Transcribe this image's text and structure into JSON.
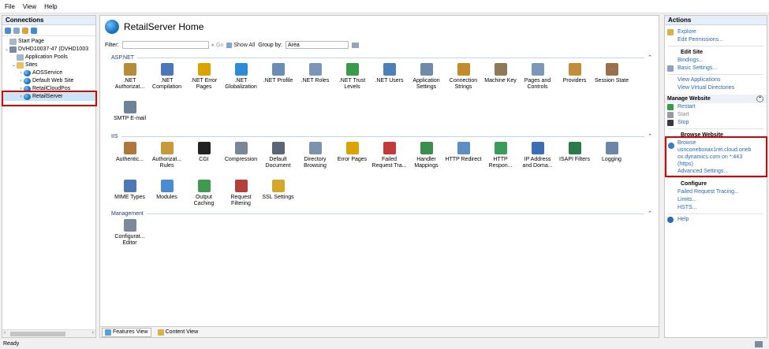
{
  "menu": [
    "File",
    "View",
    "Help"
  ],
  "connections": {
    "title": "Connections",
    "tree": [
      {
        "label": "Start Page",
        "indent": 0,
        "icon": "start-page-icon"
      },
      {
        "label": "DVHD10037-47 (DVHD1003",
        "indent": 0,
        "icon": "server-icon",
        "chev": "⌄"
      },
      {
        "label": "Application Pools",
        "indent": 1,
        "icon": "app-pools-icon"
      },
      {
        "label": "Sites",
        "indent": 1,
        "icon": "sites-folder-icon",
        "chev": "⌄"
      },
      {
        "label": "AOSService",
        "indent": 2,
        "icon": "globe-icon",
        "chev": "›"
      },
      {
        "label": "Default Web Site",
        "indent": 2,
        "icon": "globe-icon",
        "chev": "›"
      },
      {
        "label": "RetailCloudPos",
        "indent": 2,
        "icon": "globe-icon",
        "chev": "›"
      },
      {
        "label": "RetailServer",
        "indent": 2,
        "icon": "globe-icon",
        "chev": "›",
        "selected": true
      }
    ]
  },
  "main": {
    "title": "RetailServer Home",
    "filter_label": "Filter:",
    "go_label": "Go",
    "show_all_label": "Show All",
    "group_by_label": "Group by:",
    "group_by_value": "Area",
    "sections": [
      {
        "name": "ASP.NET",
        "rows": [
          [
            {
              "label": ".NET Authorizat...",
              "color": "#b58d3a"
            },
            {
              "label": ".NET Compilation",
              "color": "#4d78b8"
            },
            {
              "label": ".NET Error Pages",
              "color": "#d9a400"
            },
            {
              "label": ".NET Globalization",
              "color": "#2e8bd5"
            },
            {
              "label": ".NET Profile",
              "color": "#6b8cb5"
            },
            {
              "label": ".NET Roles",
              "color": "#7d95b6"
            },
            {
              "label": ".NET Trust Levels",
              "color": "#3a9a4a"
            },
            {
              "label": ".NET Users",
              "color": "#4e7fb5"
            },
            {
              "label": "Application Settings",
              "color": "#708aa8"
            },
            {
              "label": "Connection Strings",
              "color": "#c48a2e"
            },
            {
              "label": "Machine Key",
              "color": "#8e7a5a"
            },
            {
              "label": "Pages and Controls",
              "color": "#7c97b8"
            },
            {
              "label": "Providers",
              "color": "#c28d3a"
            },
            {
              "label": "Session State",
              "color": "#9a6f4c"
            }
          ],
          [
            {
              "label": "SMTP E-mail",
              "color": "#6f8397"
            }
          ]
        ]
      },
      {
        "name": "IIS",
        "rows": [
          [
            {
              "label": "Authentic...",
              "color": "#b0763a"
            },
            {
              "label": "Authorizat... Rules",
              "color": "#c59a3d"
            },
            {
              "label": "CGI",
              "color": "#222222"
            },
            {
              "label": "Compression",
              "color": "#7a8796"
            },
            {
              "label": "Default Document",
              "color": "#5a6675"
            },
            {
              "label": "Directory Browsing",
              "color": "#7b93ad"
            },
            {
              "label": "Error Pages",
              "color": "#d9a400"
            },
            {
              "label": "Failed Request Tra...",
              "color": "#c23a3a"
            },
            {
              "label": "Handler Mappings",
              "color": "#3a8f4f"
            },
            {
              "label": "HTTP Redirect",
              "color": "#5f8fc2"
            },
            {
              "label": "HTTP Respon...",
              "color": "#3c9a5a"
            },
            {
              "label": "IP Address and Doma...",
              "color": "#3b6fb3"
            },
            {
              "label": "ISAPI Filters",
              "color": "#2c7a4a"
            },
            {
              "label": "Logging",
              "color": "#6d86a8"
            }
          ],
          [
            {
              "label": "MIME Types",
              "color": "#4a79b5"
            },
            {
              "label": "Modules",
              "color": "#4d8bd0"
            },
            {
              "label": "Output Caching",
              "color": "#3f9a4f"
            },
            {
              "label": "Request Filtering",
              "color": "#b3403a"
            },
            {
              "label": "SSL Settings",
              "color": "#d4a72c"
            }
          ]
        ]
      },
      {
        "name": "Management",
        "rows": [
          [
            {
              "label": "Configurat... Editor",
              "color": "#7d8898"
            }
          ]
        ]
      }
    ],
    "tabs": {
      "features": "Features View",
      "content": "Content View"
    }
  },
  "actions": {
    "title": "Actions",
    "explore": "Explore",
    "edit_permissions": "Edit Permissions...",
    "edit_site": "Edit Site",
    "bindings": "Bindings...",
    "basic_settings": "Basic Settings...",
    "view_applications": "View Applications",
    "view_virtual_dirs": "View Virtual Directories",
    "manage_website": "Manage Website",
    "restart": "Restart",
    "start": "Start",
    "stop": "Stop",
    "browse_website": "Browse Website",
    "browse_link_1": "Browse",
    "browse_link_2": "usnconeboxax1ret.cloud.oneb",
    "browse_link_3": "ox.dynamics.com on *:443",
    "browse_link_4": "(https)",
    "advanced_settings": "Advanced Settings...",
    "configure": "Configure",
    "failed_request_tracing": "Failed Request Tracing...",
    "limits": "Limits...",
    "hsts": "HSTS...",
    "help": "Help"
  },
  "status": {
    "text": "Ready"
  },
  "colors": {
    "link": "#2a6ab2",
    "highlight": "#e00000",
    "header_band": "#e6eef8"
  }
}
